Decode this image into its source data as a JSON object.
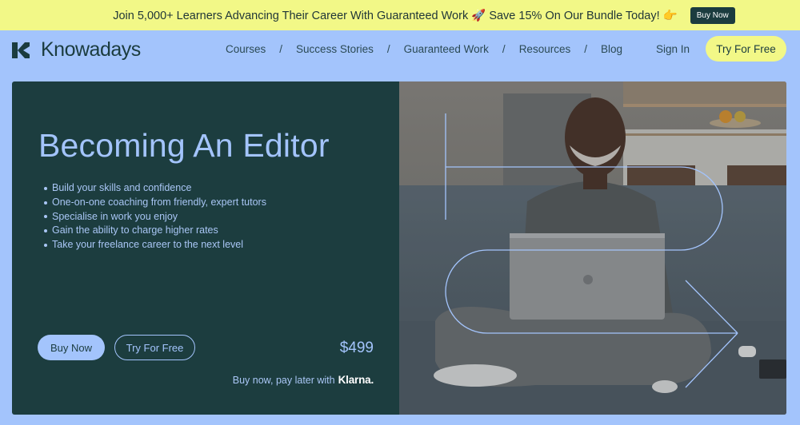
{
  "promo": {
    "text": "Join 5,000+ Learners Advancing Their Career With Guaranteed Work 🚀 Save 15% On Our Bundle Today! 👉",
    "button_label": "Buy Now"
  },
  "header": {
    "brand": "Knowadays",
    "nav": [
      {
        "label": "Courses"
      },
      {
        "label": "Success Stories"
      },
      {
        "label": "Guaranteed Work"
      },
      {
        "label": "Resources"
      },
      {
        "label": "Blog"
      }
    ],
    "separator": "/",
    "sign_in": "Sign In",
    "try_free": "Try For Free"
  },
  "hero": {
    "title": "Becoming An Editor",
    "features": [
      "Build your skills and confidence",
      "One-on-one coaching from friendly, expert tutors",
      "Specialise in work you enjoy",
      "Gain the ability to charge higher rates",
      "Take your freelance career to the next level"
    ],
    "buy_label": "Buy Now",
    "try_label": "Try For Free",
    "price": "$499",
    "pay_later": "Buy now, pay later with",
    "klarna": "Klarna.",
    "image_alt": "Smiling man sitting cross-legged on a sofa using a laptop"
  },
  "colors": {
    "promo_bg": "#f2f887",
    "page_bg": "#a3c4fc",
    "hero_dark": "#1c3d3f",
    "accent_blue": "#a3c4fc",
    "brand_dark": "#1b3c3f"
  }
}
